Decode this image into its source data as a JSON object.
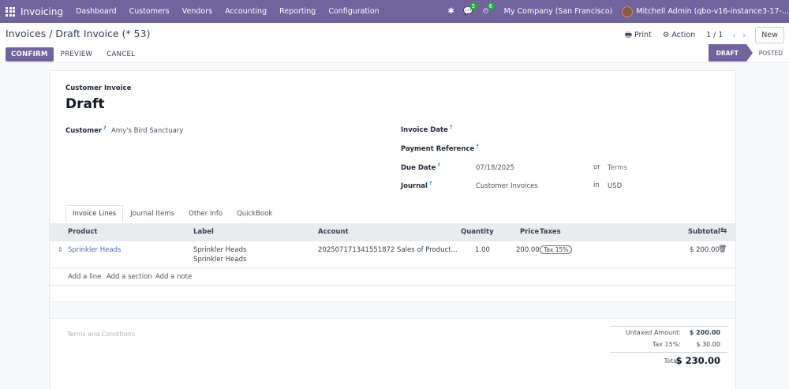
{
  "navbar": {
    "app_name": "Invoicing",
    "menu": [
      "Dashboard",
      "Customers",
      "Vendors",
      "Accounting",
      "Reporting",
      "Configuration"
    ],
    "messages_count": "5",
    "activities_count": "6",
    "company": "My Company (San Francisco)",
    "user": "Mitchell Admin (qbo-v16-instance3-17-..."
  },
  "breadcrumb": {
    "parent": "Invoices",
    "separator": "/",
    "current": "Draft Invoice (* 53)"
  },
  "control": {
    "print_label": "Print",
    "action_label": "Action",
    "pager": "1 / 1",
    "new_label": "New"
  },
  "actions": {
    "confirm": "CONFIRM",
    "preview": "PREVIEW",
    "cancel": "CANCEL"
  },
  "status": {
    "draft": "DRAFT",
    "posted": "POSTED"
  },
  "invoice": {
    "type_label": "Customer Invoice",
    "title": "Draft",
    "customer_label": "Customer",
    "customer_value": "Amy's Bird Sanctuary",
    "invoice_date_label": "Invoice Date",
    "payment_ref_label": "Payment Reference",
    "due_date_label": "Due Date",
    "due_date_value": "07/18/2025",
    "or_label": "or",
    "terms_placeholder": "Terms",
    "journal_label": "Journal",
    "journal_value": "Customer Invoices",
    "in_label": "in",
    "currency": "USD",
    "help_mark": "?"
  },
  "tabs": [
    "Invoice Lines",
    "Journal Items",
    "Other Info",
    "QuickBook"
  ],
  "lines": {
    "headers": {
      "product": "Product",
      "label": "Label",
      "account": "Account",
      "quantity": "Quantity",
      "price": "Price",
      "taxes": "Taxes",
      "subtotal": "Subtotal"
    },
    "rows": [
      {
        "product": "Sprinkler Heads",
        "label_line1": "Sprinkler Heads",
        "label_line2": "Sprinkler Heads",
        "account": "20250717134155187​2 Sales of Product...",
        "quantity": "1.00",
        "price": "200.00",
        "tax": "Tax 15%",
        "subtotal": "$ 200.00"
      }
    ],
    "add_line": "Add a line",
    "add_section": "Add a section",
    "add_note": "Add a note"
  },
  "footer": {
    "terms_placeholder": "Terms and Conditions",
    "untaxed_label": "Untaxed Amount:",
    "untaxed_value": "$ 200.00",
    "tax_label": "Tax 15%:",
    "tax_value": "$ 30.00",
    "total_label": "Total:",
    "total_value": "$ 230.00"
  }
}
